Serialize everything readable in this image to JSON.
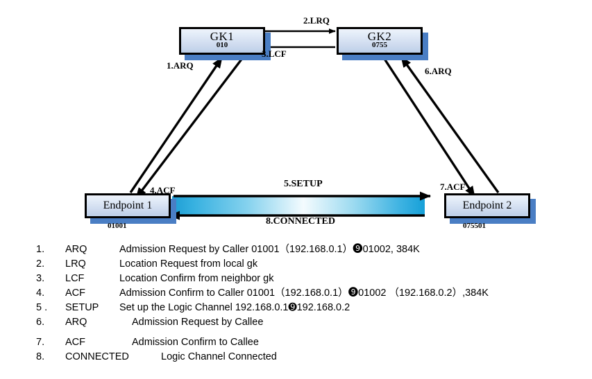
{
  "diagram": {
    "nodes": [
      {
        "id": "gk1",
        "title": "GK1",
        "sub": "010"
      },
      {
        "id": "gk2",
        "title": "GK2",
        "sub": "0755"
      },
      {
        "id": "ep1",
        "title": "Endpoint 1",
        "caption": "01001"
      },
      {
        "id": "ep2",
        "title": "Endpoint 2",
        "caption": "075501"
      }
    ],
    "edge_labels": {
      "arq1": "1.ARQ",
      "lrq2": "2.LRQ",
      "lcf3": "3.LCF",
      "acf4": "4.ACF",
      "setup5": "5.SETUP",
      "arq6": "6.ARQ",
      "acf7": "7.ACF",
      "connected8": "8.CONNECTED"
    },
    "colors": {
      "shadow_blue": "#4a7ec4",
      "band_cyan": "#29a8dc",
      "band_highlight": "#f4fbfe",
      "node_border": "#000000",
      "node_face_top": "#eef3fb",
      "node_face_bottom": "#bccfe8"
    }
  },
  "legend": {
    "rows": [
      {
        "num": "1.",
        "code": "ARQ",
        "desc": "Admission Request  by Caller 01001（192.168.0.1）➒01002,  384K",
        "code_width": 78,
        "desc_indent": 0
      },
      {
        "num": "2.",
        "code": "LRQ",
        "desc": "Location Request from local gk",
        "code_width": 78,
        "desc_indent": 0
      },
      {
        "num": "3.",
        "code": "LCF",
        "desc": "Location Confirm from neighbor gk",
        "code_width": 78,
        "desc_indent": 0
      },
      {
        "num": "4.",
        "code": "ACF",
        "desc": "Admission Confirm to Caller  01001（192.168.0.1）➒01002 （192.168.0.2）,384K",
        "code_width": 78,
        "desc_indent": 0
      },
      {
        "num": "5 .",
        "code": "SETUP",
        "desc": "Set up the Logic Channel  192.168.0.1➒192.168.0.2",
        "code_width": 78,
        "desc_indent": 0
      },
      {
        "num": "6.",
        "code": "ARQ",
        "desc": "Admission Request  by Callee",
        "code_width": 78,
        "desc_indent": 18
      },
      {
        "num": "7.",
        "code": "ACF",
        "desc": "Admission Confirm to Callee",
        "code_width": 78,
        "desc_indent": 18,
        "gap_before": true
      },
      {
        "num": "8.",
        "code": "CONNECTED",
        "desc": "Logic Channel Connected",
        "code_width": 120,
        "desc_indent": 18
      }
    ]
  }
}
